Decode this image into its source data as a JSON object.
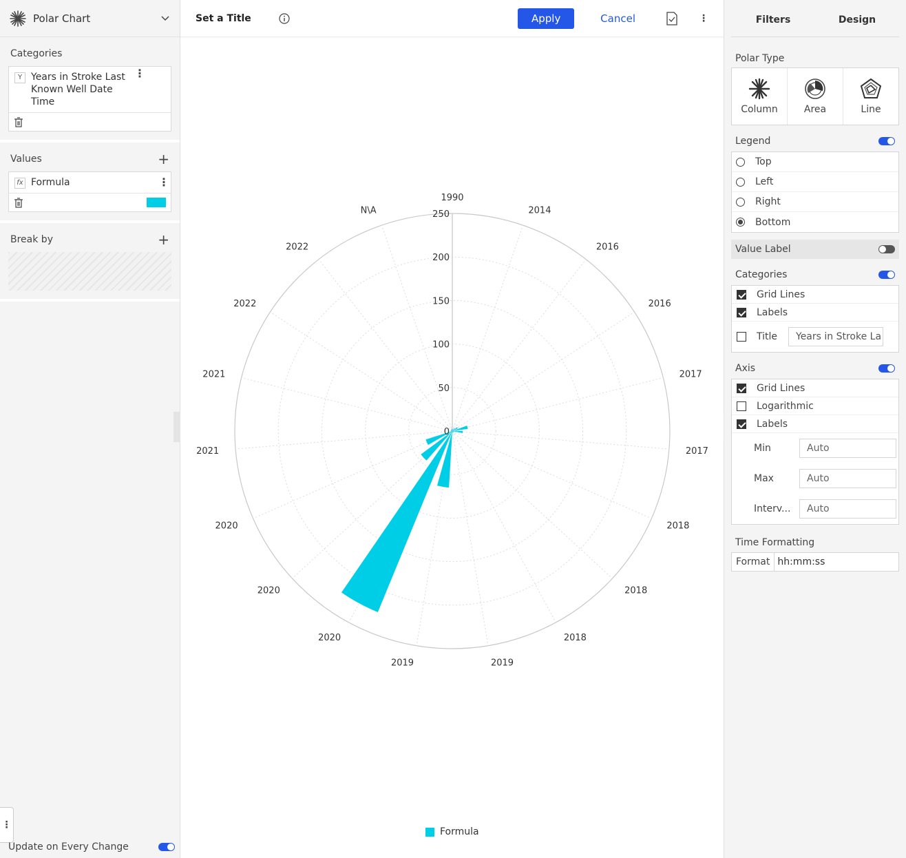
{
  "left": {
    "widget_type": "Polar Chart",
    "categories_title": "Categories",
    "category_field": "Years in Stroke Last Known Well Date Time",
    "category_badge": "Y",
    "values_title": "Values",
    "value_field": "Formula",
    "value_badge": "fx",
    "value_color": "#00cee6",
    "breakby_title": "Break by",
    "update_label": "Update on Every Change"
  },
  "toolbar": {
    "title": "Set a Title",
    "apply": "Apply",
    "cancel": "Cancel"
  },
  "chart_data": {
    "type": "polar-column",
    "categories": [
      "1990",
      "2014",
      "2016",
      "2016",
      "2017",
      "2017",
      "2018",
      "2018",
      "2018",
      "2019",
      "2019",
      "2020",
      "2020",
      "2020",
      "2021",
      "2021",
      "2022",
      "2022",
      "N\\A"
    ],
    "series": [
      {
        "name": "Formula",
        "color": "#00cee6",
        "values": [
          2,
          2,
          4,
          7,
          18,
          12,
          2,
          2,
          2,
          2,
          65,
          225,
          45,
          32,
          2,
          2,
          2,
          2,
          3
        ]
      }
    ],
    "radial_ticks": [
      0,
      50,
      100,
      150,
      200,
      250
    ],
    "ylim": [
      0,
      250
    ],
    "grid": true,
    "legend": "bottom"
  },
  "design": {
    "tab_filters": "Filters",
    "tab_design": "Design",
    "polar_type_label": "Polar Type",
    "polar_types": [
      "Column",
      "Area",
      "Line"
    ],
    "legend_label": "Legend",
    "legend_options": [
      "Top",
      "Left",
      "Right",
      "Bottom"
    ],
    "legend_selected": "Bottom",
    "value_label": "Value Label",
    "categories_label": "Categories",
    "cat_grid": "Grid Lines",
    "cat_labels": "Labels",
    "cat_title": "Title",
    "cat_title_value": "Years in Stroke La",
    "axis_label": "Axis",
    "axis_grid": "Grid Lines",
    "axis_log": "Logarithmic",
    "axis_labels": "Labels",
    "min_label": "Min",
    "max_label": "Max",
    "interval_label": "Interv...",
    "auto": "Auto",
    "time_format_label": "Time Formatting",
    "format_label": "Format",
    "format_value": "hh:mm:ss"
  }
}
